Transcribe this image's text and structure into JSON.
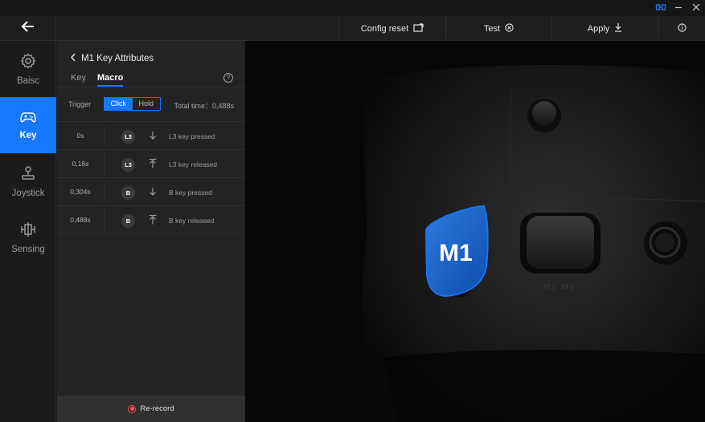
{
  "window": {
    "controls": [
      "link-icon",
      "minimize-icon",
      "close-icon"
    ]
  },
  "toolbar": {
    "back_icon": "arrow-left-icon",
    "config_reset": {
      "label": "Config reset",
      "icon": "reset-icon"
    },
    "test": {
      "label": "Test",
      "icon": "circle-x-icon"
    },
    "apply": {
      "label": "Apply",
      "icon": "download-icon"
    },
    "info_icon": "info-icon"
  },
  "nav": {
    "items": [
      {
        "label": "Baisc",
        "icon": "gear-icon"
      },
      {
        "label": "Key",
        "icon": "gamepad-icon"
      },
      {
        "label": "Joystick",
        "icon": "joystick-icon"
      },
      {
        "label": "Sensing",
        "icon": "sensing-icon"
      }
    ],
    "active": "Key"
  },
  "panel": {
    "title": "M1 Key Attributes",
    "tabs": [
      "Key",
      "Macro"
    ],
    "active_tab": "Macro",
    "trigger_label": "Trigger",
    "trigger_options": [
      "Click",
      "Hold"
    ],
    "trigger_selected": "Click",
    "total_time": "Total time：0,488s",
    "rows": [
      {
        "time": "0s",
        "key": "L3",
        "action": "down",
        "text": "L3 key pressed"
      },
      {
        "time": "0,16s",
        "key": "L3",
        "action": "up",
        "text": "L3 key released"
      },
      {
        "time": "0,304s",
        "key": "B",
        "action": "down",
        "text": "B key pressed"
      },
      {
        "time": "0,488s",
        "key": "B",
        "action": "up",
        "text": "B key released"
      }
    ],
    "rerecord_label": "Re-record"
  },
  "device": {
    "highlight_label": "M1",
    "engraving": "M1 M3",
    "accent": "#1677ff"
  },
  "colors": {
    "accent": "#1677ff",
    "record": "#ff4d4f"
  }
}
